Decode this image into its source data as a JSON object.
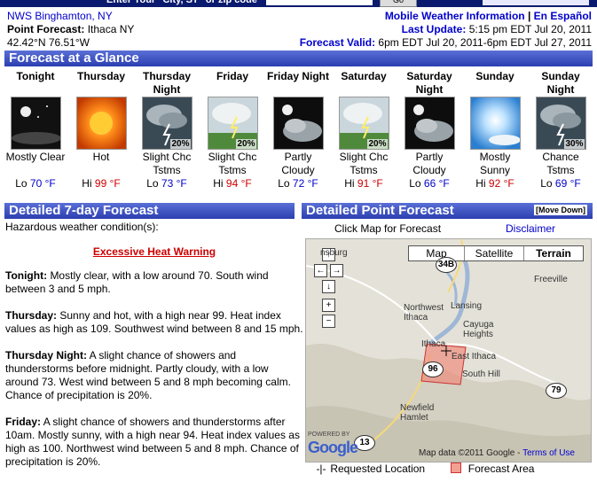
{
  "header": {
    "site": "NWS Binghamton, NY",
    "point_label": "Point Forecast:",
    "point_value": "Ithaca NY",
    "coords": "42.42°N 76.51°W",
    "mobile_link": "Mobile Weather Information",
    "sep": "|",
    "espanol_link": "En Español",
    "last_update_label": "Last Update:",
    "last_update_value": "5:15 pm EDT Jul 20, 2011",
    "valid_label": "Forecast Valid:",
    "valid_value": "6pm EDT Jul 20, 2011-6pm EDT Jul 27, 2011"
  },
  "glance": {
    "title": "Forecast at a Glance",
    "periods": [
      {
        "name": "Tonight",
        "desc": "Mostly Clear",
        "temp_label": "Lo",
        "temp": "70",
        "unit": "°F",
        "icon": "night-clear-icon",
        "pop": ""
      },
      {
        "name": "Thursday",
        "desc": "Hot",
        "temp_label": "Hi",
        "temp": "99",
        "unit": "°F",
        "icon": "hot-sun-icon",
        "pop": ""
      },
      {
        "name": "Thursday Night",
        "desc": "Slight Chc Tstms",
        "temp_label": "Lo",
        "temp": "73",
        "unit": "°F",
        "icon": "night-tstorm-icon",
        "pop": "20%"
      },
      {
        "name": "Friday",
        "desc": "Slight Chc Tstms",
        "temp_label": "Hi",
        "temp": "94",
        "unit": "°F",
        "icon": "day-tstorm-icon",
        "pop": "20%"
      },
      {
        "name": "Friday Night",
        "desc": "Partly Cloudy",
        "temp_label": "Lo",
        "temp": "72",
        "unit": "°F",
        "icon": "night-partly-cloudy-icon",
        "pop": ""
      },
      {
        "name": "Saturday",
        "desc": "Slight Chc Tstms",
        "temp_label": "Hi",
        "temp": "91",
        "unit": "°F",
        "icon": "day-tstorm-icon",
        "pop": "20%"
      },
      {
        "name": "Saturday Night",
        "desc": "Partly Cloudy",
        "temp_label": "Lo",
        "temp": "66",
        "unit": "°F",
        "icon": "night-partly-cloudy-icon",
        "pop": ""
      },
      {
        "name": "Sunday",
        "desc": "Mostly Sunny",
        "temp_label": "Hi",
        "temp": "92",
        "unit": "°F",
        "icon": "mostly-sunny-icon",
        "pop": ""
      },
      {
        "name": "Sunday Night",
        "desc": "Chance Tstms",
        "temp_label": "Lo",
        "temp": "69",
        "unit": "°F",
        "icon": "night-tstorm-icon",
        "pop": "30%"
      }
    ]
  },
  "detailed": {
    "title": "Detailed 7-day Forecast",
    "hazard_intro": "Hazardous weather condition(s):",
    "hazard_link": "Excessive Heat Warning",
    "periods": [
      {
        "name": "Tonight:",
        "text": "Mostly clear, with a low around 70. South wind between 3 and 5 mph."
      },
      {
        "name": "Thursday:",
        "text": "Sunny and hot, with a high near 99. Heat index values as high as 109. Southwest wind between 8 and 15 mph."
      },
      {
        "name": "Thursday Night:",
        "text": "A slight chance of showers and thunderstorms before midnight. Partly cloudy, with a low around 73. West wind between 5 and 8 mph becoming calm. Chance of precipitation is 20%."
      },
      {
        "name": "Friday:",
        "text": "A slight chance of showers and thunderstorms after 10am. Mostly sunny, with a high near 94. Heat index values as high as 100. Northwest wind between 5 and 8 mph. Chance of precipitation is 20%."
      }
    ]
  },
  "point": {
    "title": "Detailed Point Forecast",
    "move_down": "[Move Down]",
    "click_map": "Click Map for Forecast",
    "disclaimer": "Disclaimer",
    "map_types": [
      "Map",
      "Satellite",
      "Terrain"
    ],
    "map_type_selected": "Terrain",
    "places": [
      "nsburg",
      "Freeville",
      "Northwest Ithaca",
      "Lansing",
      "Cayuga Heights",
      "Ithaca",
      "East Ithaca",
      "South Hill",
      "Newfield Hamlet"
    ],
    "routes": [
      "34B",
      "96",
      "79",
      "13"
    ],
    "powered_by": "POWERED BY",
    "google": "Google",
    "map_data": "Map data ©2011 Google -",
    "terms": "Terms of Use",
    "legend_requested": "Requested Location",
    "legend_area": "Forecast Area"
  },
  "colors": {
    "header_bar": "#3a4fc4",
    "hi": "#cc0000",
    "lo": "#0000cc",
    "link": "#0000cc",
    "forecast_area": "#f3a090"
  }
}
